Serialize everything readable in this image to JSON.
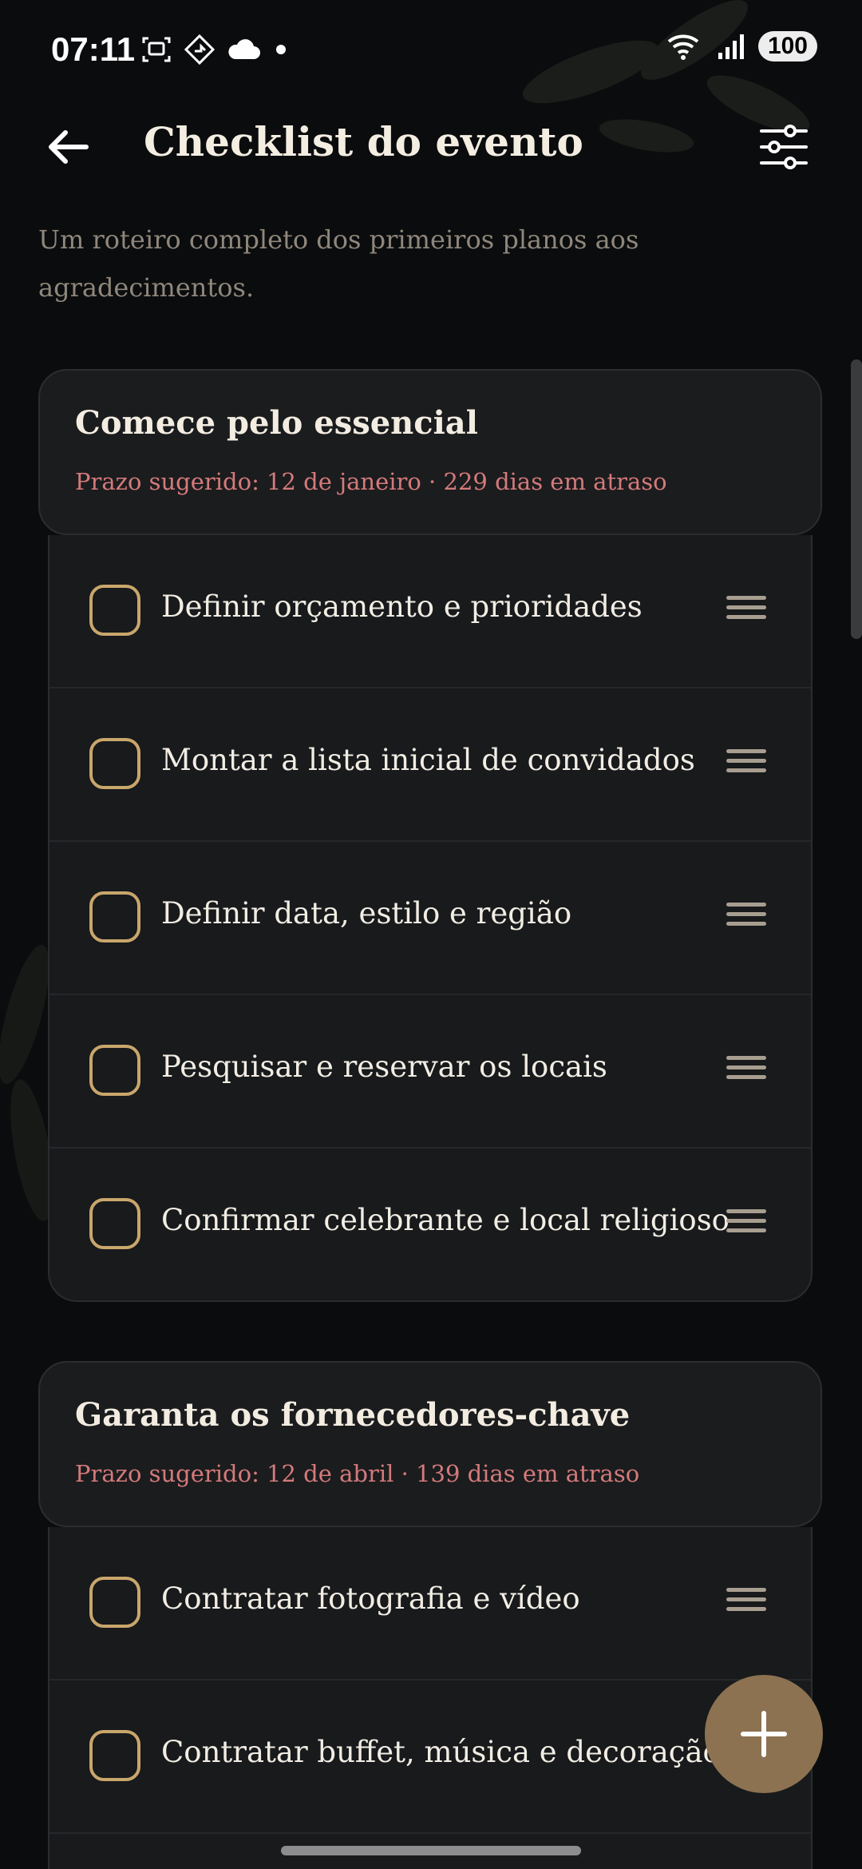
{
  "status_bar": {
    "time": "07:11",
    "battery": "100",
    "icons_left": [
      "screenshot-icon",
      "location-diamond-icon",
      "cloud-icon",
      "dot-icon"
    ],
    "icons_right": [
      "wifi-icon",
      "signal-icon",
      "battery-icon"
    ]
  },
  "header": {
    "title": "Checklist do evento",
    "back_icon": "arrow-left-icon",
    "filter_icon": "sliders-icon"
  },
  "subtitle": "Um roteiro completo dos primeiros planos aos agradecimentos.",
  "sections": [
    {
      "title": "Comece pelo essencial",
      "deadline": "Prazo sugerido: 12 de janeiro · 229 dias em atraso",
      "tasks": [
        {
          "label": "Definir orçamento e prioridades",
          "checked": false
        },
        {
          "label": "Montar a lista inicial de convidados",
          "checked": false
        },
        {
          "label": "Definir data, estilo e região",
          "checked": false
        },
        {
          "label": "Pesquisar e reservar os locais",
          "checked": false
        },
        {
          "label": "Confirmar celebrante e local religioso",
          "checked": false
        }
      ]
    },
    {
      "title": "Garanta os fornecedores-chave",
      "deadline": "Prazo sugerido: 12 de abril · 139 dias em atraso",
      "tasks": [
        {
          "label": "Contratar fotografia e vídeo",
          "checked": false
        },
        {
          "label": "Contratar buffet, música e decoração",
          "checked": false
        }
      ]
    }
  ],
  "fab_icon": "plus-icon",
  "colors": {
    "background": "#0b0c0d",
    "card": "#1b1c1e",
    "accent_gold": "#c9a66b",
    "deadline_red": "#d47a7b",
    "fab": "#8c7251"
  }
}
